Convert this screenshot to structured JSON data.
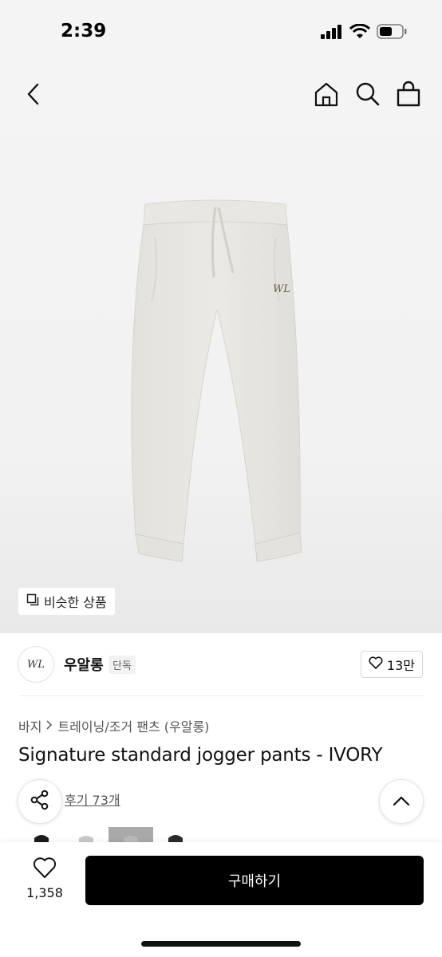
{
  "status_bar": {
    "time": "2:39"
  },
  "product": {
    "similar_label": "비슷한 상품",
    "brand_logo_text": "WL",
    "brand_name": "우알롱",
    "brand_badge": "단독",
    "like_count": "13만",
    "breadcrumb": [
      "바지",
      "트레이닝/조거 팬츠 (우알롱)"
    ],
    "title": "Signature standard jogger pants - IVORY",
    "review_link": "후기 73개"
  },
  "bottom_bar": {
    "wish_count": "1,358",
    "buy_label": "구매하기"
  },
  "colors": {
    "accent": "#000000",
    "pants": "#e6e4df",
    "background": "#f3f3f3"
  },
  "icons": [
    "back-icon",
    "home-icon",
    "search-icon",
    "cart-icon",
    "copy-icon",
    "heart-icon",
    "share-icon",
    "chevron-up-icon",
    "chevron-right-icon"
  ]
}
